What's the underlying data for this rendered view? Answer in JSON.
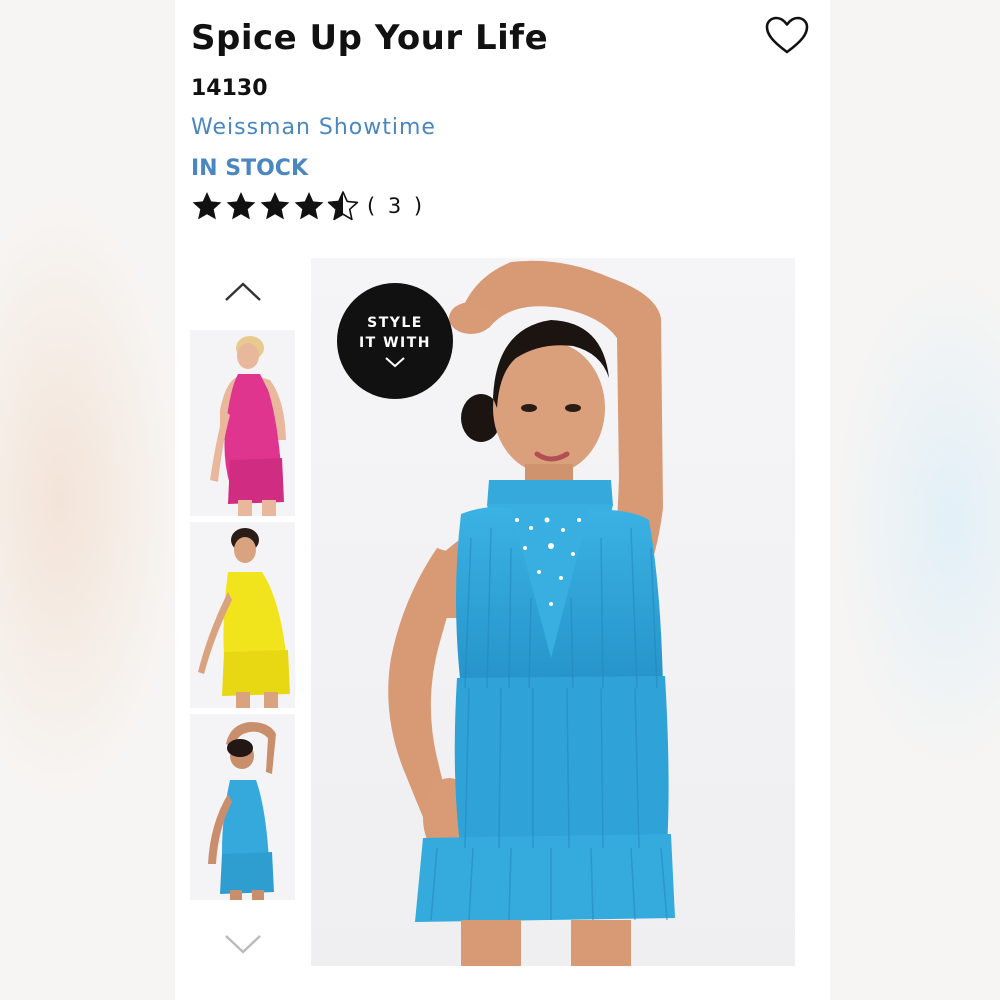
{
  "product": {
    "title": "Spice Up Your Life",
    "sku": "14130",
    "brand": "Weissman Showtime",
    "stock_status": "IN STOCK",
    "rating": 4.5,
    "review_count": "( 3 )"
  },
  "badge": {
    "line1": "STYLE",
    "line2": "IT WITH"
  },
  "thumbnails": [
    {
      "color": "#e0358f",
      "icon": "pink-costume-thumbnail"
    },
    {
      "color": "#f2e41c",
      "icon": "yellow-costume-thumbnail"
    },
    {
      "color": "#35a9dc",
      "icon": "blue-costume-thumbnail"
    }
  ],
  "colors": {
    "accent": "#4a86c0",
    "text": "#111111",
    "costume_main": "#35a9dc"
  }
}
